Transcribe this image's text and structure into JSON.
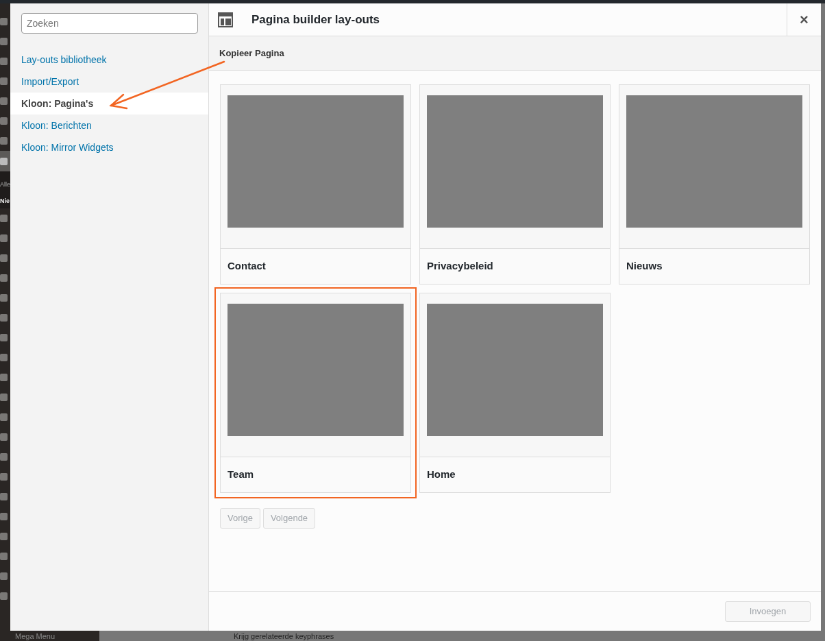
{
  "admin_menu": {
    "submenu": [
      "Alle",
      "Nie"
    ],
    "footer_item": "Mega Menu"
  },
  "background_bar": {
    "text": "Krijg gerelateerde keyphrases"
  },
  "sidebar": {
    "search": {
      "placeholder": "Zoeken"
    },
    "items": [
      {
        "label": "Lay-outs bibliotheek",
        "selected": false
      },
      {
        "label": "Import/Export",
        "selected": false
      },
      {
        "label": "Kloon: Pagina's",
        "selected": true
      },
      {
        "label": "Kloon: Berichten",
        "selected": false
      },
      {
        "label": "Kloon: Mirror Widgets",
        "selected": false
      }
    ]
  },
  "modal": {
    "title": "Pagina builder lay-outs",
    "close": "×",
    "subtitle": "Kopieer Pagina"
  },
  "cards": [
    {
      "title": "Contact",
      "highlighted": false
    },
    {
      "title": "Privacybeleid",
      "highlighted": false
    },
    {
      "title": "Nieuws",
      "highlighted": false
    },
    {
      "title": "Team",
      "highlighted": true
    },
    {
      "title": "Home",
      "highlighted": false
    }
  ],
  "pagination": [
    {
      "label": "Vorige",
      "disabled": true
    },
    {
      "label": "Volgende",
      "disabled": true
    }
  ],
  "insert_button": {
    "label": "Invoegen",
    "disabled": true
  }
}
